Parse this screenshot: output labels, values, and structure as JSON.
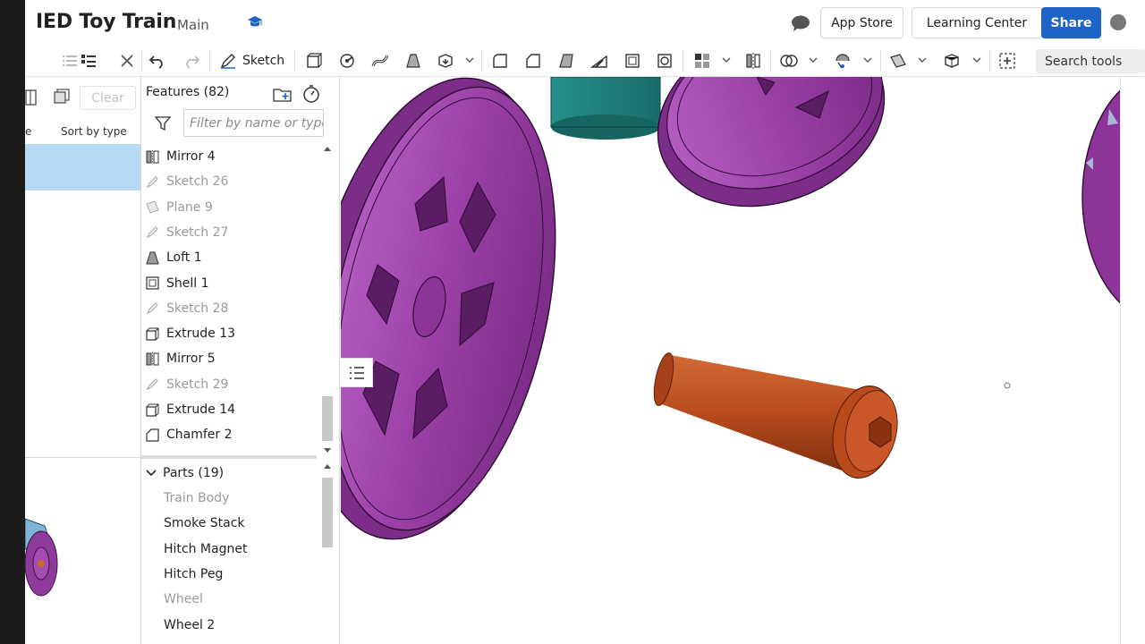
{
  "header": {
    "title": "IED Toy Train",
    "branch": "Main",
    "app_store_label": "App Store",
    "learning_center_label": "Learning Center",
    "share_label": "Share"
  },
  "toolbar": {
    "sketch_label": "Sketch",
    "search_tools_label": "Search tools"
  },
  "left_pane": {
    "clear_label": "Clear",
    "sort_label": "Sort by type",
    "truncated_column_label": "e"
  },
  "features": {
    "title": "Features (82)",
    "filter_placeholder": "Filter by name or type",
    "items": [
      {
        "label": "Mirror 4",
        "icon": "mirror-icon",
        "suppressed": false
      },
      {
        "label": "Sketch 26",
        "icon": "sketch-icon",
        "suppressed": true
      },
      {
        "label": "Plane 9",
        "icon": "plane-icon",
        "suppressed": true
      },
      {
        "label": "Sketch 27",
        "icon": "sketch-icon",
        "suppressed": true
      },
      {
        "label": "Loft 1",
        "icon": "loft-icon",
        "suppressed": false
      },
      {
        "label": "Shell 1",
        "icon": "shell-icon",
        "suppressed": false
      },
      {
        "label": "Sketch 28",
        "icon": "sketch-icon",
        "suppressed": true
      },
      {
        "label": "Extrude 13",
        "icon": "extrude-icon",
        "suppressed": false
      },
      {
        "label": "Mirror 5",
        "icon": "mirror-icon",
        "suppressed": false
      },
      {
        "label": "Sketch 29",
        "icon": "sketch-icon",
        "suppressed": true
      },
      {
        "label": "Extrude 14",
        "icon": "extrude-icon",
        "suppressed": false
      },
      {
        "label": "Chamfer 2",
        "icon": "chamfer-icon",
        "suppressed": false
      }
    ]
  },
  "parts": {
    "title": "Parts (19)",
    "items": [
      {
        "label": "Train Body",
        "hidden": true
      },
      {
        "label": "Smoke Stack",
        "hidden": false
      },
      {
        "label": "Hitch Magnet",
        "hidden": false
      },
      {
        "label": "Hitch Peg",
        "hidden": false
      },
      {
        "label": "Wheel",
        "hidden": true
      },
      {
        "label": "Wheel 2",
        "hidden": false
      }
    ]
  },
  "colors": {
    "accent": "#1e63c6",
    "wheel": "#9b3fa6",
    "wheel_dark": "#6e2778",
    "bolt": "#b84a1c",
    "stack": "#1f7e7a",
    "selection": "#b5daf6"
  }
}
